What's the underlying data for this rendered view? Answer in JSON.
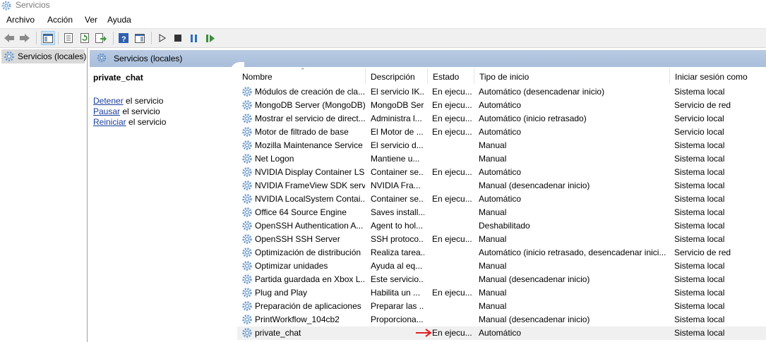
{
  "window": {
    "title": "Servicios"
  },
  "menu": [
    "Archivo",
    "Acción",
    "Ver",
    "Ayuda"
  ],
  "toolbar": {
    "icons": [
      "back-arrow-icon",
      "forward-arrow-icon",
      "show-hide-console-tree-icon",
      "properties-icon",
      "refresh-icon",
      "export-list-icon",
      "help-icon",
      "show-hide-action-pane-icon",
      "start-service-icon",
      "stop-service-icon",
      "pause-service-icon",
      "resume-service-icon"
    ]
  },
  "tree": {
    "root_label": "Servicios (locales)"
  },
  "panel": {
    "header": "Servicios (locales)"
  },
  "details": {
    "service_name": "private_chat",
    "actions": [
      {
        "link": "Detener",
        "rest": " el servicio"
      },
      {
        "link": "Pausar",
        "rest": " el servicio"
      },
      {
        "link": "Reiniciar",
        "rest": " el servicio"
      }
    ]
  },
  "table": {
    "columns": [
      "Nombre",
      "Descripción",
      "Estado",
      "Tipo de inicio",
      "Iniciar sesión como"
    ],
    "sorted_column": "Nombre",
    "rows": [
      [
        "Módulos de creación de cla...",
        "El servicio IK...",
        "En ejecu...",
        "Automático (desencadenar inicio)",
        "Sistema local"
      ],
      [
        "MongoDB Server (MongoDB)",
        "MongoDB Ser...",
        "En ejecu...",
        "Automático",
        "Servicio de red"
      ],
      [
        "Mostrar el servicio de direct...",
        "Administra l...",
        "En ejecu...",
        "Automático (inicio retrasado)",
        "Servicio local"
      ],
      [
        "Motor de filtrado de base",
        "El Motor de ...",
        "En ejecu...",
        "Automático",
        "Servicio local"
      ],
      [
        "Mozilla Maintenance Service",
        "El servicio d...",
        "",
        "Manual",
        "Sistema local"
      ],
      [
        "Net Logon",
        "Mantiene u...",
        "",
        "Manual",
        "Sistema local"
      ],
      [
        "NVIDIA Display Container LS",
        "Container se...",
        "En ejecu...",
        "Automático",
        "Sistema local"
      ],
      [
        "NVIDIA FrameView SDK serv...",
        "NVIDIA Fra...",
        "",
        "Manual (desencadenar inicio)",
        "Sistema local"
      ],
      [
        "NVIDIA LocalSystem Contai...",
        "Container se...",
        "En ejecu...",
        "Automático",
        "Sistema local"
      ],
      [
        "Office 64 Source Engine",
        "Saves install...",
        "",
        "Manual",
        "Sistema local"
      ],
      [
        "OpenSSH Authentication A...",
        "Agent to hol...",
        "",
        "Deshabilitado",
        "Sistema local"
      ],
      [
        "OpenSSH SSH Server",
        "SSH protoco...",
        "En ejecu...",
        "Manual",
        "Sistema local"
      ],
      [
        "Optimización de distribución",
        "Realiza tarea...",
        "",
        "Automático (inicio retrasado, desencadenar inici...",
        "Servicio de red"
      ],
      [
        "Optimizar unidades",
        "Ayuda al eq...",
        "",
        "Manual",
        "Sistema local"
      ],
      [
        "Partida guardada en Xbox L...",
        "Este servicio...",
        "",
        "Manual (desencadenar inicio)",
        "Sistema local"
      ],
      [
        "Plug and Play",
        "Habilita un ...",
        "En ejecu...",
        "Manual",
        "Sistema local"
      ],
      [
        "Preparación de aplicaciones",
        "Preparar las ...",
        "",
        "Manual",
        "Sistema local"
      ],
      [
        "PrintWorkflow_104cb2",
        "Proporciona...",
        "",
        "Manual (desencadenar inicio)",
        "Sistema local"
      ],
      [
        "private_chat",
        "",
        "En ejecu...",
        "Automático",
        "Sistema local"
      ]
    ],
    "selected_row": 18
  },
  "colors": {
    "header_bg": "#b3c7e1",
    "link": "#1a3e9f",
    "annotation_arrow": "#e02020",
    "play": "#3a8f3a",
    "pause": "#2a6fc0"
  }
}
